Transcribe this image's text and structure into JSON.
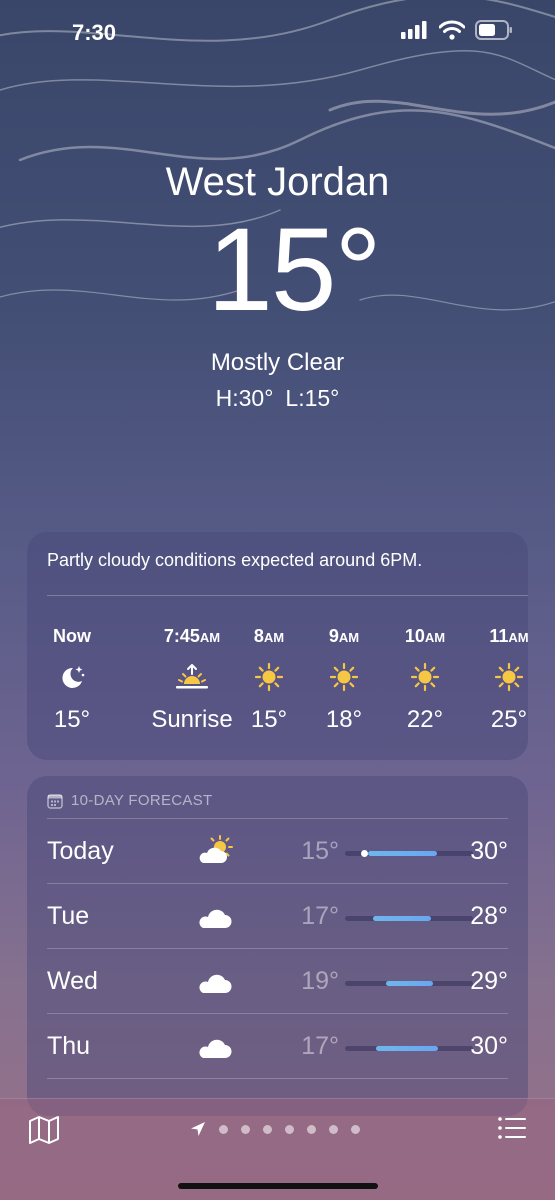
{
  "status_bar": {
    "time": "7:30"
  },
  "location": {
    "city": "West Jordan",
    "temperature": "15°",
    "condition": "Mostly Clear",
    "high": "H:30°",
    "low": "L:15°"
  },
  "hourly": {
    "summary": "Partly cloudy conditions expected around 6PM.",
    "items": [
      {
        "time": "Now",
        "suffix": "",
        "icon": "moon-stars-icon",
        "temp": "15°"
      },
      {
        "time": "7:45",
        "suffix": "AM",
        "icon": "sunrise-icon",
        "temp": "Sunrise"
      },
      {
        "time": "8",
        "suffix": "AM",
        "icon": "sun-icon",
        "temp": "15°"
      },
      {
        "time": "9",
        "suffix": "AM",
        "icon": "sun-icon",
        "temp": "18°"
      },
      {
        "time": "10",
        "suffix": "AM",
        "icon": "sun-icon",
        "temp": "22°"
      },
      {
        "time": "11",
        "suffix": "AM",
        "icon": "sun-icon",
        "temp": "25°"
      }
    ]
  },
  "daily": {
    "header": "10-DAY FORECAST",
    "days": [
      {
        "day": "Today",
        "icon": "partly-sunny-cloud-icon",
        "low": "15°",
        "high": "30°",
        "bar_start": 0.18,
        "bar_end": 0.72,
        "current": 0.15
      },
      {
        "day": "Tue",
        "icon": "cloud-icon",
        "low": "17°",
        "high": "28°",
        "bar_start": 0.22,
        "bar_end": 0.67
      },
      {
        "day": "Wed",
        "icon": "cloud-icon",
        "low": "19°",
        "high": "29°",
        "bar_start": 0.32,
        "bar_end": 0.69
      },
      {
        "day": "Thu",
        "icon": "cloud-icon",
        "low": "17°",
        "high": "30°",
        "bar_start": 0.24,
        "bar_end": 0.73
      }
    ]
  },
  "bottom_bar": {
    "page_dots": 7
  },
  "colors": {
    "sun": "#f6c744",
    "bar": "#6aa6f2"
  }
}
